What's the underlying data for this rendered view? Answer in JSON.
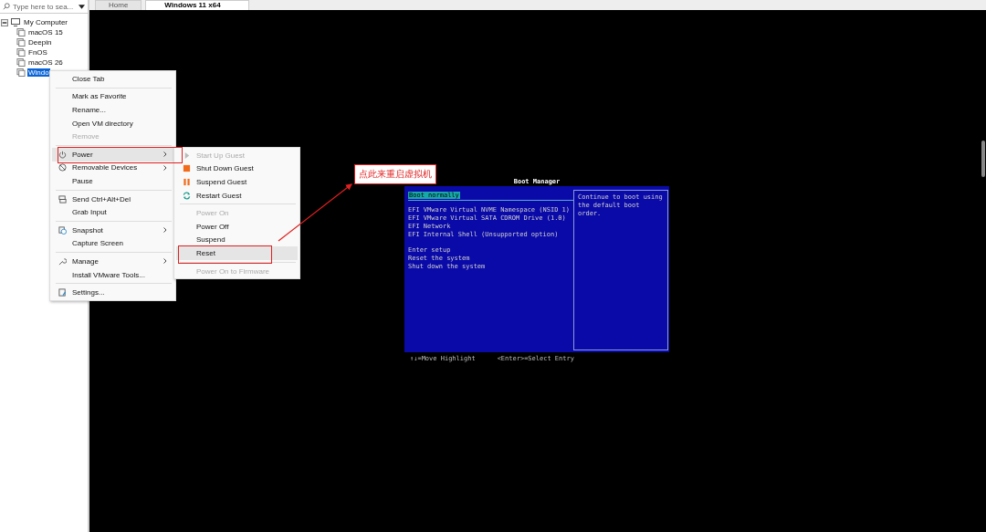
{
  "search": {
    "placeholder": "Type here to sea..."
  },
  "tree": [
    {
      "label": "My Computer",
      "expanded": true,
      "selected": false,
      "children": [
        {
          "label": "macOS 15",
          "selected": false
        },
        {
          "label": "Deepin",
          "selected": false
        },
        {
          "label": "FnOS",
          "selected": false
        },
        {
          "label": "macOS 26",
          "selected": false
        },
        {
          "label": "Windo",
          "selected": true
        }
      ]
    }
  ],
  "tabs": [
    {
      "label": "Home",
      "selected": false
    },
    {
      "label": "Windows 11 x64",
      "selected": true
    }
  ],
  "context_menu": [
    {
      "kind": "item",
      "label": "Close Tab",
      "disabled": false,
      "submenu": false,
      "selected": false
    },
    {
      "kind": "separator"
    },
    {
      "kind": "item",
      "label": "Mark as Favorite",
      "disabled": false,
      "submenu": false,
      "selected": false
    },
    {
      "kind": "item",
      "label": "Rename...",
      "disabled": false,
      "submenu": false,
      "selected": false
    },
    {
      "kind": "item",
      "label": "Open VM directory",
      "disabled": false,
      "submenu": false,
      "selected": false
    },
    {
      "kind": "item",
      "label": "Remove",
      "disabled": true,
      "submenu": false,
      "selected": false
    },
    {
      "kind": "separator"
    },
    {
      "kind": "item",
      "label": "Power",
      "disabled": false,
      "submenu": true,
      "selected": true
    },
    {
      "kind": "item",
      "label": "Removable Devices",
      "disabled": false,
      "submenu": true,
      "selected": false
    },
    {
      "kind": "item",
      "label": "Pause",
      "disabled": false,
      "submenu": false,
      "selected": false
    },
    {
      "kind": "separator"
    },
    {
      "kind": "item",
      "label": "Send Ctrl+Alt+Del",
      "disabled": false,
      "submenu": false,
      "selected": false
    },
    {
      "kind": "item",
      "label": "Grab Input",
      "disabled": false,
      "submenu": false,
      "selected": false
    },
    {
      "kind": "separator"
    },
    {
      "kind": "item",
      "label": "Snapshot",
      "disabled": false,
      "submenu": true,
      "selected": false
    },
    {
      "kind": "item",
      "label": "Capture Screen",
      "disabled": false,
      "submenu": false,
      "selected": false
    },
    {
      "kind": "separator"
    },
    {
      "kind": "item",
      "label": "Manage",
      "disabled": false,
      "submenu": true,
      "selected": false
    },
    {
      "kind": "item",
      "label": "Install VMware Tools...",
      "disabled": false,
      "submenu": false,
      "selected": false
    },
    {
      "kind": "separator"
    },
    {
      "kind": "item",
      "label": "Settings...",
      "disabled": false,
      "submenu": false,
      "selected": false
    }
  ],
  "power_submenu": [
    {
      "kind": "item",
      "label": "Start Up Guest",
      "disabled": true,
      "selected": false
    },
    {
      "kind": "item",
      "label": "Shut Down Guest",
      "disabled": false,
      "selected": false
    },
    {
      "kind": "item",
      "label": "Suspend Guest",
      "disabled": false,
      "selected": false
    },
    {
      "kind": "item",
      "label": "Restart Guest",
      "disabled": false,
      "selected": false
    },
    {
      "kind": "separator"
    },
    {
      "kind": "item",
      "label": "Power On",
      "disabled": true,
      "selected": false
    },
    {
      "kind": "item",
      "label": "Power Off",
      "disabled": false,
      "selected": false
    },
    {
      "kind": "item",
      "label": "Suspend",
      "disabled": false,
      "selected": false
    },
    {
      "kind": "item",
      "label": "Reset",
      "disabled": false,
      "selected": true
    },
    {
      "kind": "separator"
    },
    {
      "kind": "item",
      "label": "Power On to Firmware",
      "disabled": true,
      "selected": false
    }
  ],
  "annotation": {
    "text": "点此来重启虚拟机"
  },
  "boot_manager": {
    "title": "Boot Manager",
    "sections": [
      [
        {
          "label": "Boot normally",
          "selected": true
        }
      ],
      [
        {
          "label": "EFI VMware Virtual NVME Namespace (NSID 1)",
          "selected": false
        },
        {
          "label": "EFI VMware Virtual SATA CDROM Drive (1.0)",
          "selected": false
        },
        {
          "label": "EFI Network",
          "selected": false
        },
        {
          "label": "EFI Internal Shell (Unsupported option)",
          "selected": false
        }
      ],
      [
        {
          "label": "Enter setup",
          "selected": false
        },
        {
          "label": "Reset the system",
          "selected": false
        },
        {
          "label": "Shut down the system",
          "selected": false
        }
      ]
    ],
    "help": "Continue to boot using the default boot order.",
    "footer": [
      "↑↓=Move Highlight",
      "<Enter>=Select Entry"
    ]
  }
}
